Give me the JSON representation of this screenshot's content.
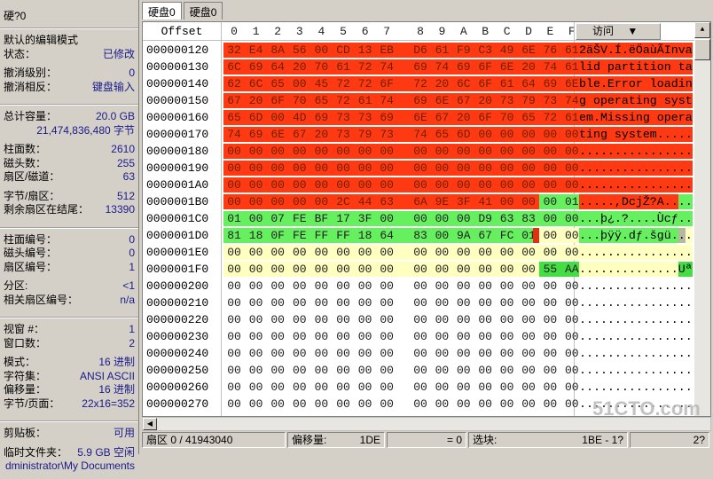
{
  "left_panel": {
    "title": "硬?0",
    "groups": [
      [
        {
          "label": "默认的编辑模式",
          "value": ""
        },
        {
          "label": "状态：",
          "value": "已修改"
        }
      ],
      [
        {
          "label": "撤消级别：",
          "value": "0"
        },
        {
          "label": "撤消相反：",
          "value": "键盘输入"
        }
      ],
      "sep",
      [
        {
          "label": "总计容量：",
          "value": "20.0 GB"
        },
        {
          "label": "",
          "value": "21,474,836,480 字节"
        }
      ],
      [
        {
          "label": "柱面数：",
          "value": "2610"
        },
        {
          "label": "磁头数：",
          "value": "255"
        },
        {
          "label": "扇区/磁道：",
          "value": "63"
        }
      ],
      [
        {
          "label": "字节/扇区：",
          "value": "512"
        },
        {
          "label": "剩余扇区在结尾：",
          "value": "13390"
        }
      ],
      "sep",
      [
        {
          "label": "柱面编号：",
          "value": "0"
        },
        {
          "label": "磁头编号：",
          "value": "0"
        },
        {
          "label": "扇区编号：",
          "value": "1"
        }
      ],
      [
        {
          "label": "分区:",
          "value": "<1"
        },
        {
          "label": "相关扇区编号：",
          "value": "n/a"
        }
      ],
      "sep",
      [
        {
          "label": "视窗 #：",
          "value": "1"
        },
        {
          "label": "窗口数：",
          "value": "2"
        }
      ],
      [
        {
          "label": "模式：",
          "value": "16 进制"
        },
        {
          "label": "字符集：",
          "value": "ANSI ASCII"
        },
        {
          "label": "偏移量：",
          "value": "16 进制"
        },
        {
          "label": "字节/页面：",
          "value": "22x16=352"
        }
      ],
      "sep",
      [
        {
          "label": "剪贴板：",
          "value": "可用"
        }
      ],
      [
        {
          "label": "临时文件夹：",
          "value": "5.9 GB 空闲"
        },
        {
          "label": "",
          "value": "dministrator\\My Documents"
        }
      ]
    ]
  },
  "tabs": [
    {
      "label": "硬盘0",
      "active": true
    },
    {
      "label": "硬盘0",
      "active": false
    }
  ],
  "editor": {
    "offset_header": "Offset",
    "columns": [
      "0",
      "1",
      "2",
      "3",
      "4",
      "5",
      "6",
      "7",
      "8",
      "9",
      "A",
      "B",
      "C",
      "D",
      "E",
      "F"
    ],
    "access_label": "访问",
    "cursor_offset": "1DE",
    "rows": [
      {
        "offset": "000000120",
        "hex": "32 E4 8A 56 00 CD 13 EB D6 61 F9 C3 49 6E 76 61",
        "ascii": "2äŠV.Í.ëÖaùÃInva"
      },
      {
        "offset": "000000130",
        "hex": "6C 69 64 20 70 61 72 74 69 74 69 6F 6E 20 74 61",
        "ascii": "lid partition ta"
      },
      {
        "offset": "000000140",
        "hex": "62 6C 65 00 45 72 72 6F 72 20 6C 6F 61 64 69 6E",
        "ascii": "ble.Error loadin"
      },
      {
        "offset": "000000150",
        "hex": "67 20 6F 70 65 72 61 74 69 6E 67 20 73 79 73 74",
        "ascii": "g operating syst"
      },
      {
        "offset": "000000160",
        "hex": "65 6D 00 4D 69 73 73 69 6E 67 20 6F 70 65 72 61",
        "ascii": "em.Missing opera"
      },
      {
        "offset": "000000170",
        "hex": "74 69 6E 67 20 73 79 73 74 65 6D 00 00 00 00 00",
        "ascii": "ting system....."
      },
      {
        "offset": "000000180",
        "hex": "00 00 00 00 00 00 00 00 00 00 00 00 00 00 00 00",
        "ascii": "................"
      },
      {
        "offset": "000000190",
        "hex": "00 00 00 00 00 00 00 00 00 00 00 00 00 00 00 00",
        "ascii": "................"
      },
      {
        "offset": "0000001A0",
        "hex": "00 00 00 00 00 00 00 00 00 00 00 00 00 00 00 00",
        "ascii": "................"
      },
      {
        "offset": "0000001B0",
        "hex": "00 00 00 00 00 2C 44 63 6A 9E 3F 41 00 00 00 01",
        "ascii": ".....,DcjŽ?A...."
      },
      {
        "offset": "0000001C0",
        "hex": "01 00 07 FE BF 17 3F 00 00 00 00 D9 63 83 00 00",
        "ascii": "...þ¿.?....Ùcƒ.."
      },
      {
        "offset": "0000001D0",
        "hex": "81 18 0F FE FF FF 18 64 83 00 9A 67 FC 01 00 00",
        "ascii": "...þÿÿ.dƒ.šgü..."
      },
      {
        "offset": "0000001E0",
        "hex": "00 00 00 00 00 00 00 00 00 00 00 00 00 00 00 00",
        "ascii": "................"
      },
      {
        "offset": "0000001F0",
        "hex": "00 00 00 00 00 00 00 00 00 00 00 00 00 00 55 AA",
        "ascii": "..............Uª"
      },
      {
        "offset": "000000200",
        "hex": "00 00 00 00 00 00 00 00 00 00 00 00 00 00 00 00",
        "ascii": "................"
      },
      {
        "offset": "000000210",
        "hex": "00 00 00 00 00 00 00 00 00 00 00 00 00 00 00 00",
        "ascii": "................"
      },
      {
        "offset": "000000220",
        "hex": "00 00 00 00 00 00 00 00 00 00 00 00 00 00 00 00",
        "ascii": "................"
      },
      {
        "offset": "000000230",
        "hex": "00 00 00 00 00 00 00 00 00 00 00 00 00 00 00 00",
        "ascii": "................"
      },
      {
        "offset": "000000240",
        "hex": "00 00 00 00 00 00 00 00 00 00 00 00 00 00 00 00",
        "ascii": "................"
      },
      {
        "offset": "000000250",
        "hex": "00 00 00 00 00 00 00 00 00 00 00 00 00 00 00 00",
        "ascii": "................"
      },
      {
        "offset": "000000260",
        "hex": "00 00 00 00 00 00 00 00 00 00 00 00 00 00 00 00",
        "ascii": "................"
      },
      {
        "offset": "000000270",
        "hex": "00 00 00 00 00 00 00 00 00 00 00 00 00 00 00 00",
        "ascii": "................"
      }
    ],
    "highlights": [
      {
        "from": "120",
        "to": "1BD",
        "color": "#ff3a12"
      },
      {
        "from": "1BE",
        "to": "1DD",
        "color": "#66f060"
      },
      {
        "from": "1DE",
        "to": "1FD",
        "color": "#ffffc0"
      },
      {
        "from": "1FE",
        "to": "1FF",
        "color": "#44dd44"
      }
    ]
  },
  "status": {
    "sector": "扇区 0 / 41943040",
    "offset_label": "偏移量:",
    "offset_value": "1DE",
    "value": "= 0",
    "block_label": "选块:",
    "block_value": "1BE - 1?",
    "tail": "2?"
  },
  "watermark": "51CTO.com 技术博客 Blog"
}
